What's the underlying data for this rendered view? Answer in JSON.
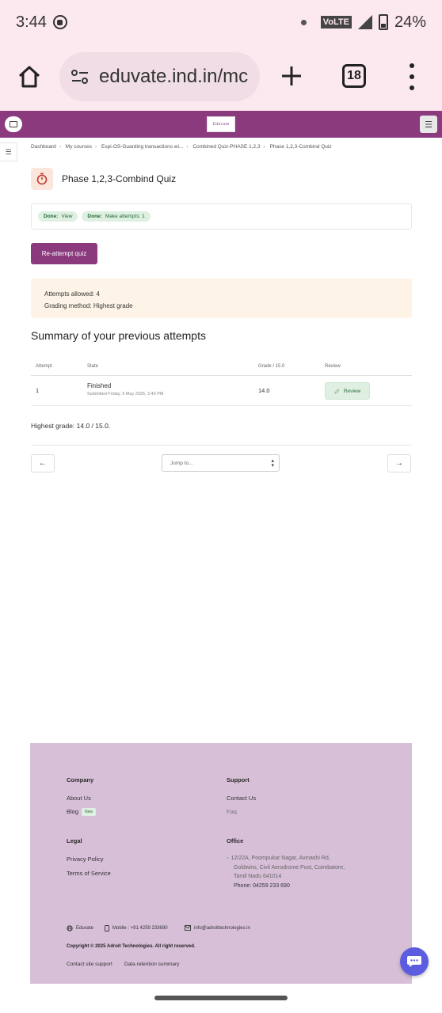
{
  "status_bar": {
    "time": "3:44",
    "network_badge": "VoLTE",
    "battery": "24%"
  },
  "browser": {
    "url": "eduvate.ind.in/mc",
    "tab_count": "18"
  },
  "site": {
    "logo_text": "Eduvate"
  },
  "breadcrumb": [
    "Dashboard",
    "My courses",
    "Espi-OS-Guarding transactions wi...",
    "Combined Quiz-PHASE 1,2,3",
    "Phase 1,2,3-Combind Quiz"
  ],
  "page": {
    "title": "Phase 1,2,3-Combind Quiz"
  },
  "completion": [
    {
      "label": "Done:",
      "text": "View"
    },
    {
      "label": "Done:",
      "text": "Make attempts: 1"
    }
  ],
  "reattempt_label": "Re-attempt quiz",
  "info": {
    "attempts_allowed": "Attempts allowed: 4",
    "grading_method": "Grading method: Highest grade"
  },
  "summary": {
    "title": "Summary of your previous attempts",
    "headers": {
      "attempt": "Attempt",
      "state": "State",
      "grade": "Grade / 15.0",
      "review": "Review"
    },
    "rows": [
      {
        "attempt": "1",
        "state": "Finished",
        "submitted": "Submitted Friday, 9 May 2025, 3:43 PM",
        "grade": "14.0",
        "review": "Review"
      }
    ]
  },
  "highest_grade": "Highest grade: 14.0 / 15.0.",
  "navigation": {
    "prev": "←",
    "next": "→",
    "jump_placeholder": "Jump to..."
  },
  "footer": {
    "company": {
      "heading": "Company",
      "about": "About Us",
      "blog": "Blog",
      "new_badge": "New"
    },
    "support": {
      "heading": "Support",
      "contact": "Contact Us",
      "faq": "Faq"
    },
    "legal": {
      "heading": "Legal",
      "privacy": "Privacy Policy",
      "terms": "Terms of Service"
    },
    "office": {
      "heading": "Office",
      "address_line1": "12/22A, Poompukar Nagar, Avinashi Rd,",
      "address_line2": "Goldwins, Civil Aerodrome Post, Coimbatore,",
      "address_line3": "Tamil Nadu 641014",
      "phone": "Phone: 04259 233 690"
    },
    "brand": "Eduvate",
    "mobile": "Mobile : +91 4259 233690",
    "email": "info@adroittechnologies.in",
    "copyright": "Copyright © 2025 Adroit Technologies. All right reserved.",
    "contact_support": "Contact site support",
    "data_retention": "Data retention summary"
  },
  "colors": {
    "primary": "#8b3a7e",
    "footer_bg": "#d7bfd8",
    "info_bg": "#fdf4e7",
    "success_bg": "#dff0e2",
    "chrome_bg": "#fce8ef",
    "chat": "#5c5ce0"
  }
}
